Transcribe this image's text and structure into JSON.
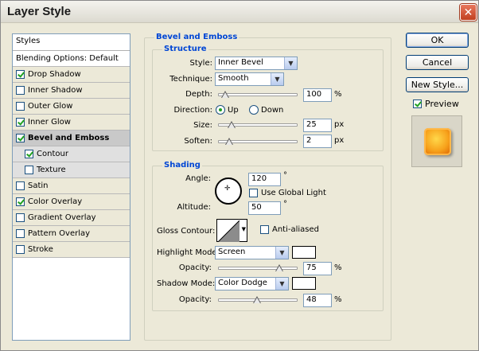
{
  "window": {
    "title": "Layer Style",
    "close_glyph": "✕"
  },
  "styles_panel": {
    "header": "Styles",
    "blending_options": "Blending Options: Default",
    "items": [
      {
        "label": "Drop Shadow",
        "checked": true
      },
      {
        "label": "Inner Shadow",
        "checked": false
      },
      {
        "label": "Outer Glow",
        "checked": false
      },
      {
        "label": "Inner Glow",
        "checked": true
      },
      {
        "label": "Bevel and Emboss",
        "checked": true,
        "selected": true
      },
      {
        "label": "Contour",
        "checked": true,
        "sub": true
      },
      {
        "label": "Texture",
        "checked": false,
        "sub": true
      },
      {
        "label": "Satin",
        "checked": false
      },
      {
        "label": "Color Overlay",
        "checked": true
      },
      {
        "label": "Gradient Overlay",
        "checked": false
      },
      {
        "label": "Pattern Overlay",
        "checked": false
      },
      {
        "label": "Stroke",
        "checked": false
      }
    ]
  },
  "bevel": {
    "section_title": "Bevel and Emboss",
    "structure": {
      "title": "Structure",
      "style_label": "Style:",
      "style_value": "Inner Bevel",
      "technique_label": "Technique:",
      "technique_value": "Smooth",
      "depth_label": "Depth:",
      "depth_value": "100",
      "depth_unit": "%",
      "direction_label": "Direction:",
      "direction_up": "Up",
      "direction_down": "Down",
      "size_label": "Size:",
      "size_value": "25",
      "size_unit": "px",
      "soften_label": "Soften:",
      "soften_value": "2",
      "soften_unit": "px"
    },
    "shading": {
      "title": "Shading",
      "angle_label": "Angle:",
      "angle_value": "120",
      "angle_unit": "°",
      "use_global_light": "Use Global Light",
      "altitude_label": "Altitude:",
      "altitude_value": "50",
      "altitude_unit": "°",
      "gloss_contour_label": "Gloss Contour:",
      "anti_aliased": "Anti-aliased",
      "highlight_mode_label": "Highlight Mode:",
      "highlight_mode_value": "Screen",
      "highlight_opacity_label": "Opacity:",
      "highlight_opacity_value": "75",
      "highlight_opacity_unit": "%",
      "shadow_mode_label": "Shadow Mode:",
      "shadow_mode_value": "Color Dodge",
      "shadow_opacity_label": "Opacity:",
      "shadow_opacity_value": "48",
      "shadow_opacity_unit": "%"
    }
  },
  "buttons": {
    "ok": "OK",
    "cancel": "Cancel",
    "new_style": "New Style...",
    "preview": "Preview"
  }
}
